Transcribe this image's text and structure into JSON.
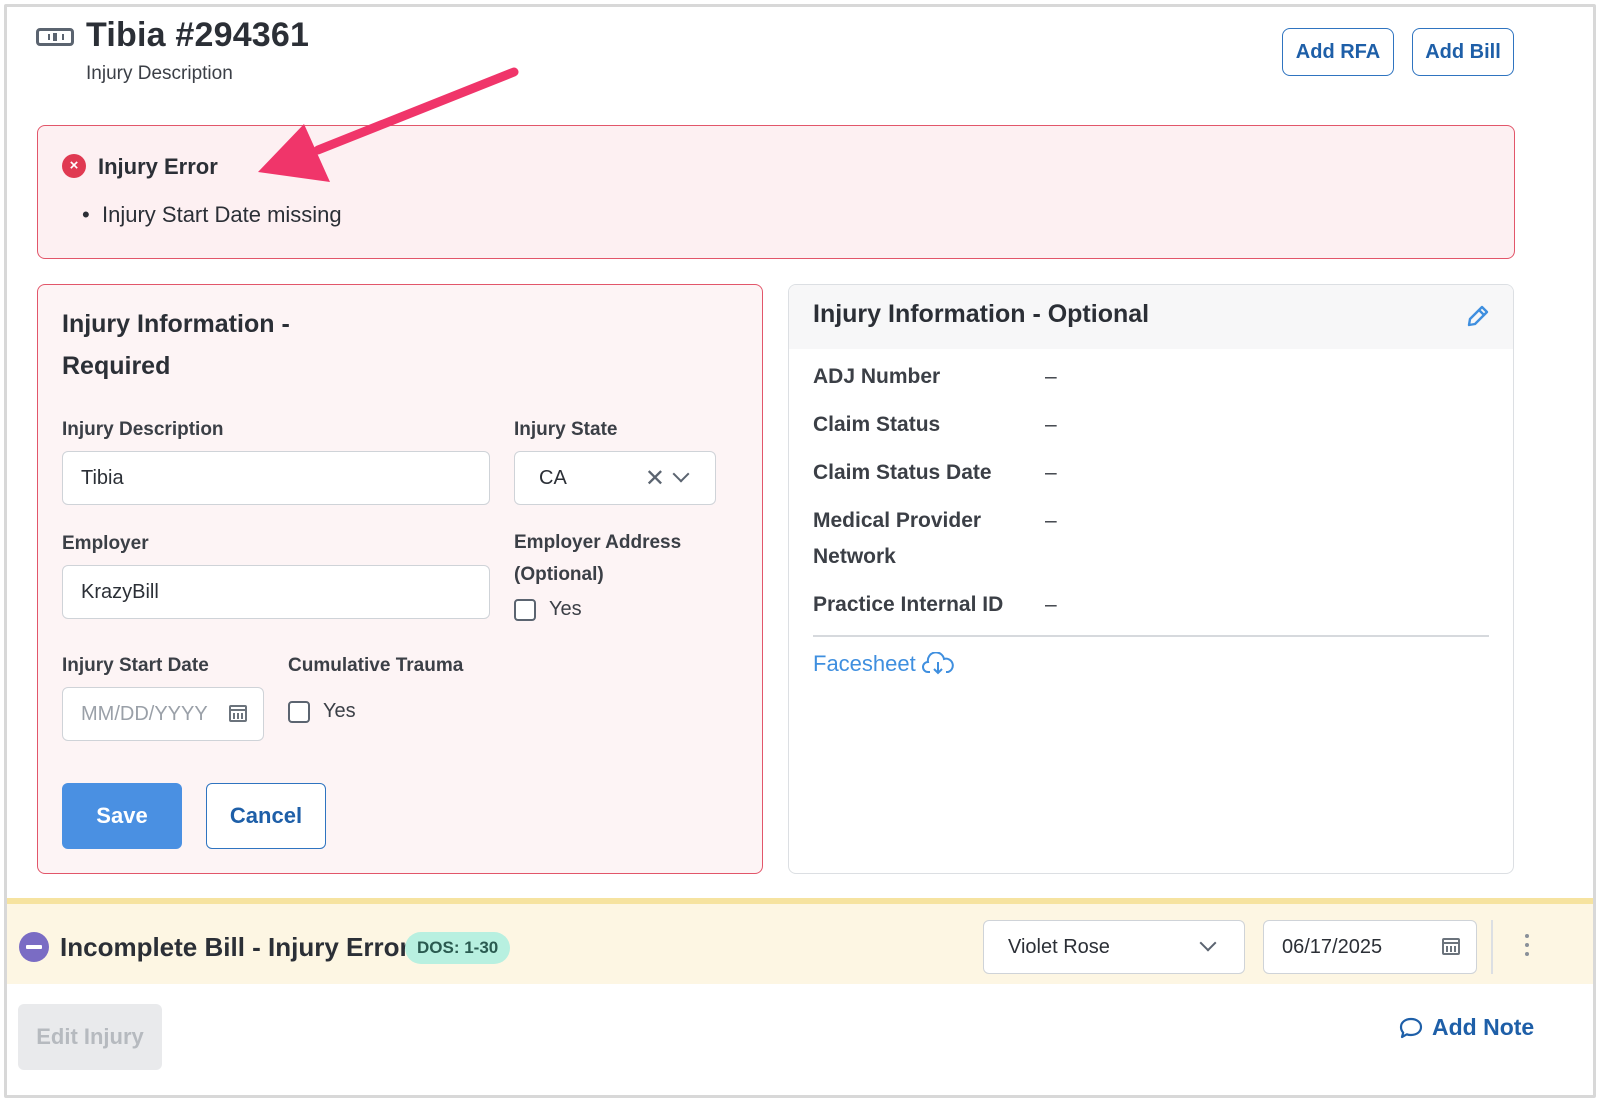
{
  "header": {
    "title": "Tibia #294361",
    "subtitle": "Injury Description",
    "icon": "bone-card-icon",
    "add_rfa_label": "Add RFA",
    "add_bill_label": "Add Bill"
  },
  "error_banner": {
    "title": "Injury Error",
    "items": [
      "Injury Start Date missing"
    ],
    "icon": "error-x-icon",
    "color": "#e03a52"
  },
  "required_card": {
    "title": "Injury Information - Required",
    "injury_description": {
      "label": "Injury Description",
      "value": "Tibia"
    },
    "injury_state": {
      "label": "Injury State",
      "value": "CA"
    },
    "employer": {
      "label": "Employer",
      "value": "KrazyBill"
    },
    "employer_address": {
      "label": "Employer Address (Optional)",
      "checkbox_label": "Yes",
      "checked": false
    },
    "injury_start_date": {
      "label": "Injury Start Date",
      "placeholder": "MM/DD/YYYY",
      "value": ""
    },
    "cumulative_trauma": {
      "label": "Cumulative Trauma",
      "checkbox_label": "Yes",
      "checked": false
    },
    "save_label": "Save",
    "cancel_label": "Cancel"
  },
  "optional_card": {
    "title": "Injury Information - Optional",
    "rows": [
      {
        "label": "ADJ Number",
        "value": "–"
      },
      {
        "label": "Claim Status",
        "value": "–"
      },
      {
        "label": "Claim Status Date",
        "value": "–"
      },
      {
        "label": "Medical Provider Network",
        "value": "–"
      },
      {
        "label": "Practice Internal ID",
        "value": "–"
      }
    ],
    "facesheet_label": "Facesheet"
  },
  "bill_bar": {
    "title": "Incomplete Bill - Injury Error",
    "dos_badge": "DOS: 1-30",
    "assignee": "Violet Rose",
    "date": "06/17/2025"
  },
  "footer": {
    "edit_injury_label": "Edit Injury",
    "add_note_label": "Add Note"
  },
  "colors": {
    "accent": "#2f74c0",
    "primary_button": "#4a90e2",
    "error": "#e2566a",
    "annotation_arrow": "#f0356a",
    "bill_status_icon": "#7a6cc4",
    "dos_badge": "#b8f0e0"
  }
}
